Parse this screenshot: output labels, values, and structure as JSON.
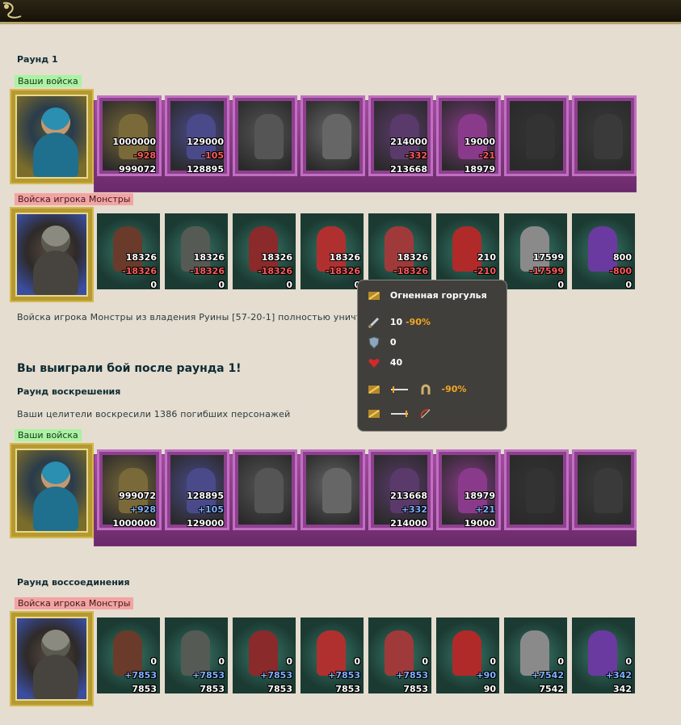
{
  "round1": {
    "title": "Раунд 1",
    "your_label": "Ваши войска",
    "enemy_label": "Войска игрока Монстры",
    "your_units": [
      {
        "n1": "1000000",
        "n2": "-928",
        "n3": "999072",
        "color": "#7a6a3a"
      },
      {
        "n1": "129000",
        "n2": "-105",
        "n3": "128895",
        "color": "#4a4a8a"
      },
      {
        "n1": "",
        "n2": "",
        "n3": "",
        "color": "#555555"
      },
      {
        "n1": "",
        "n2": "",
        "n3": "",
        "color": "#666666"
      },
      {
        "n1": "214000",
        "n2": "-332",
        "n3": "213668",
        "color": "#5a3a6a"
      },
      {
        "n1": "19000",
        "n2": "-21",
        "n3": "18979",
        "color": "#8a3a8a"
      },
      {
        "n1": "",
        "n2": "",
        "n3": "",
        "color": "#333333"
      },
      {
        "n1": "",
        "n2": "",
        "n3": "",
        "color": "#3a3a3a"
      }
    ],
    "enemy_units": [
      {
        "n1": "18326",
        "n2": "-18326",
        "n3": "0",
        "color": "#6a3a2a"
      },
      {
        "n1": "18326",
        "n2": "-18326",
        "n3": "0",
        "color": "#555a55"
      },
      {
        "n1": "18326",
        "n2": "-18326",
        "n3": "0",
        "color": "#8a2a2a"
      },
      {
        "n1": "18326",
        "n2": "-18326",
        "n3": "0",
        "color": "#b03030"
      },
      {
        "n1": "18326",
        "n2": "-18326",
        "n3": "0",
        "color": "#a03a3a"
      },
      {
        "n1": "210",
        "n2": "-210",
        "n3": "0",
        "color": "#b02a2a"
      },
      {
        "n1": "17599",
        "n2": "-17599",
        "n3": "0",
        "color": "#8a8a8a"
      },
      {
        "n1": "800",
        "n2": "-800",
        "n3": "0",
        "color": "#6a3aa0"
      }
    ],
    "result_text": "Войска игрока Монстры из владения Руины [57-20-1] полностью уничтожены"
  },
  "victory_text": "Вы выиграли бой после раунда 1!",
  "resurrection": {
    "title": "Раунд воскрешения",
    "message": "Ваши целители воскресили 1386 погибших персонажей",
    "your_label": "Ваши войска",
    "units": [
      {
        "n1": "999072",
        "n2": "+928",
        "n3": "1000000",
        "color": "#7a6a3a"
      },
      {
        "n1": "128895",
        "n2": "+105",
        "n3": "129000",
        "color": "#4a4a8a"
      },
      {
        "n1": "",
        "n2": "",
        "n3": "",
        "color": "#555555"
      },
      {
        "n1": "",
        "n2": "",
        "n3": "",
        "color": "#666666"
      },
      {
        "n1": "213668",
        "n2": "+332",
        "n3": "214000",
        "color": "#5a3a6a"
      },
      {
        "n1": "18979",
        "n2": "+21",
        "n3": "19000",
        "color": "#8a3a8a"
      },
      {
        "n1": "",
        "n2": "",
        "n3": "",
        "color": "#333333"
      },
      {
        "n1": "",
        "n2": "",
        "n3": "",
        "color": "#3a3a3a"
      }
    ]
  },
  "reunion": {
    "title": "Раунд воссоединения",
    "enemy_label": "Войска игрока Монстры",
    "units": [
      {
        "n1": "0",
        "n2": "+7853",
        "n3": "7853",
        "color": "#6a3a2a"
      },
      {
        "n1": "0",
        "n2": "+7853",
        "n3": "7853",
        "color": "#555a55"
      },
      {
        "n1": "0",
        "n2": "+7853",
        "n3": "7853",
        "color": "#8a2a2a"
      },
      {
        "n1": "0",
        "n2": "+7853",
        "n3": "7853",
        "color": "#b03030"
      },
      {
        "n1": "0",
        "n2": "+7853",
        "n3": "7853",
        "color": "#a03a3a"
      },
      {
        "n1": "0",
        "n2": "+90",
        "n3": "90",
        "color": "#b02a2a"
      },
      {
        "n1": "0",
        "n2": "+7542",
        "n3": "7542",
        "color": "#8a8a8a"
      },
      {
        "n1": "0",
        "n2": "+342",
        "n3": "342",
        "color": "#6a3aa0"
      }
    ]
  },
  "tooltip": {
    "name": "Огненная горгулья",
    "attack": "10",
    "attack_mod": "-90%",
    "defense": "0",
    "health": "40",
    "resist_mod": "-90%"
  }
}
